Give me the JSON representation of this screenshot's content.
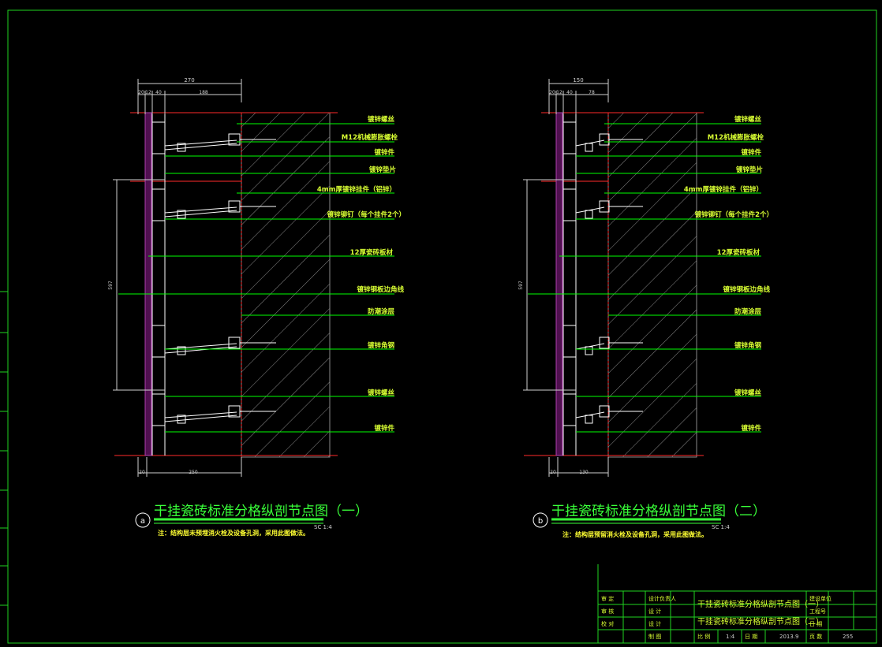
{
  "colors": {
    "background": "#000000",
    "frame": "#1fd41f",
    "dim": "#cfcfcf",
    "leader": "#00ff00",
    "label": "#d9ff33",
    "title": "#39ff39",
    "note": "#ffff33",
    "steel": "#ffffff",
    "concrete": "#8a8a8a",
    "tile": "#b040b0",
    "red": "#ff2a2a"
  },
  "details": [
    {
      "id": "a",
      "top_dim": "270",
      "sub_dims": [
        "20",
        "12",
        "40",
        "188"
      ],
      "bottom_dims": [
        "20",
        "250"
      ],
      "side_dim": "597",
      "labels": [
        "镀锌螺丝",
        "M12机械膨胀螺栓",
        "镀锌件",
        "镀锌垫片",
        "4mm厚镀锌挂件（铝锌）",
        "镀锌铆钉（每个挂件2个）",
        "12厚瓷砖板材",
        "镀锌钢板边角线",
        "防潮涂层",
        "镀锌角钢",
        "镀锌螺丝",
        "镀锌件"
      ],
      "title": "干挂瓷砖标准分格纵剖节点图（一）",
      "scale": "SC   1:4",
      "note": "注：结构层未预埋消火栓及设备孔洞，采用此图做法。"
    },
    {
      "id": "b",
      "top_dim": "150",
      "sub_dims": [
        "20",
        "12",
        "40",
        "78"
      ],
      "bottom_dims": [
        "20",
        "130"
      ],
      "side_dim": "597",
      "labels": [
        "镀锌螺丝",
        "M12机械膨胀螺栓",
        "镀锌件",
        "镀锌垫片",
        "4mm厚镀锌挂件（铝锌）",
        "镀锌铆钉（每个挂件2个）",
        "12厚瓷砖板材",
        "镀锌钢板边角线",
        "防潮涂层",
        "镀锌角钢",
        "镀锌螺丝",
        "镀锌件"
      ],
      "title": "干挂瓷砖标准分格纵剖节点图（二）",
      "scale": "SC   1:4",
      "note": "注：结构层预留消火栓及设备孔洞，采用此图做法。"
    }
  ],
  "title_block": {
    "roles": [
      "审  定",
      "审  核",
      "校  对"
    ],
    "designer_col": [
      "设计负责人",
      "设  计",
      "设  计",
      "制  图"
    ],
    "drawing_names": [
      "干挂瓷砖标准分格纵剖节点图（一）",
      "干挂瓷砖标准分格纵剖节点图（二）"
    ],
    "company_label": "建设单位",
    "project_label": "工程号",
    "date_label": "日  期",
    "bottom": {
      "scale_label": "比  例",
      "scale_value": "1:4",
      "date_label": "日  期",
      "date_value": "2013.9",
      "sheet_label": "页  数",
      "sheet_value": "255"
    }
  }
}
